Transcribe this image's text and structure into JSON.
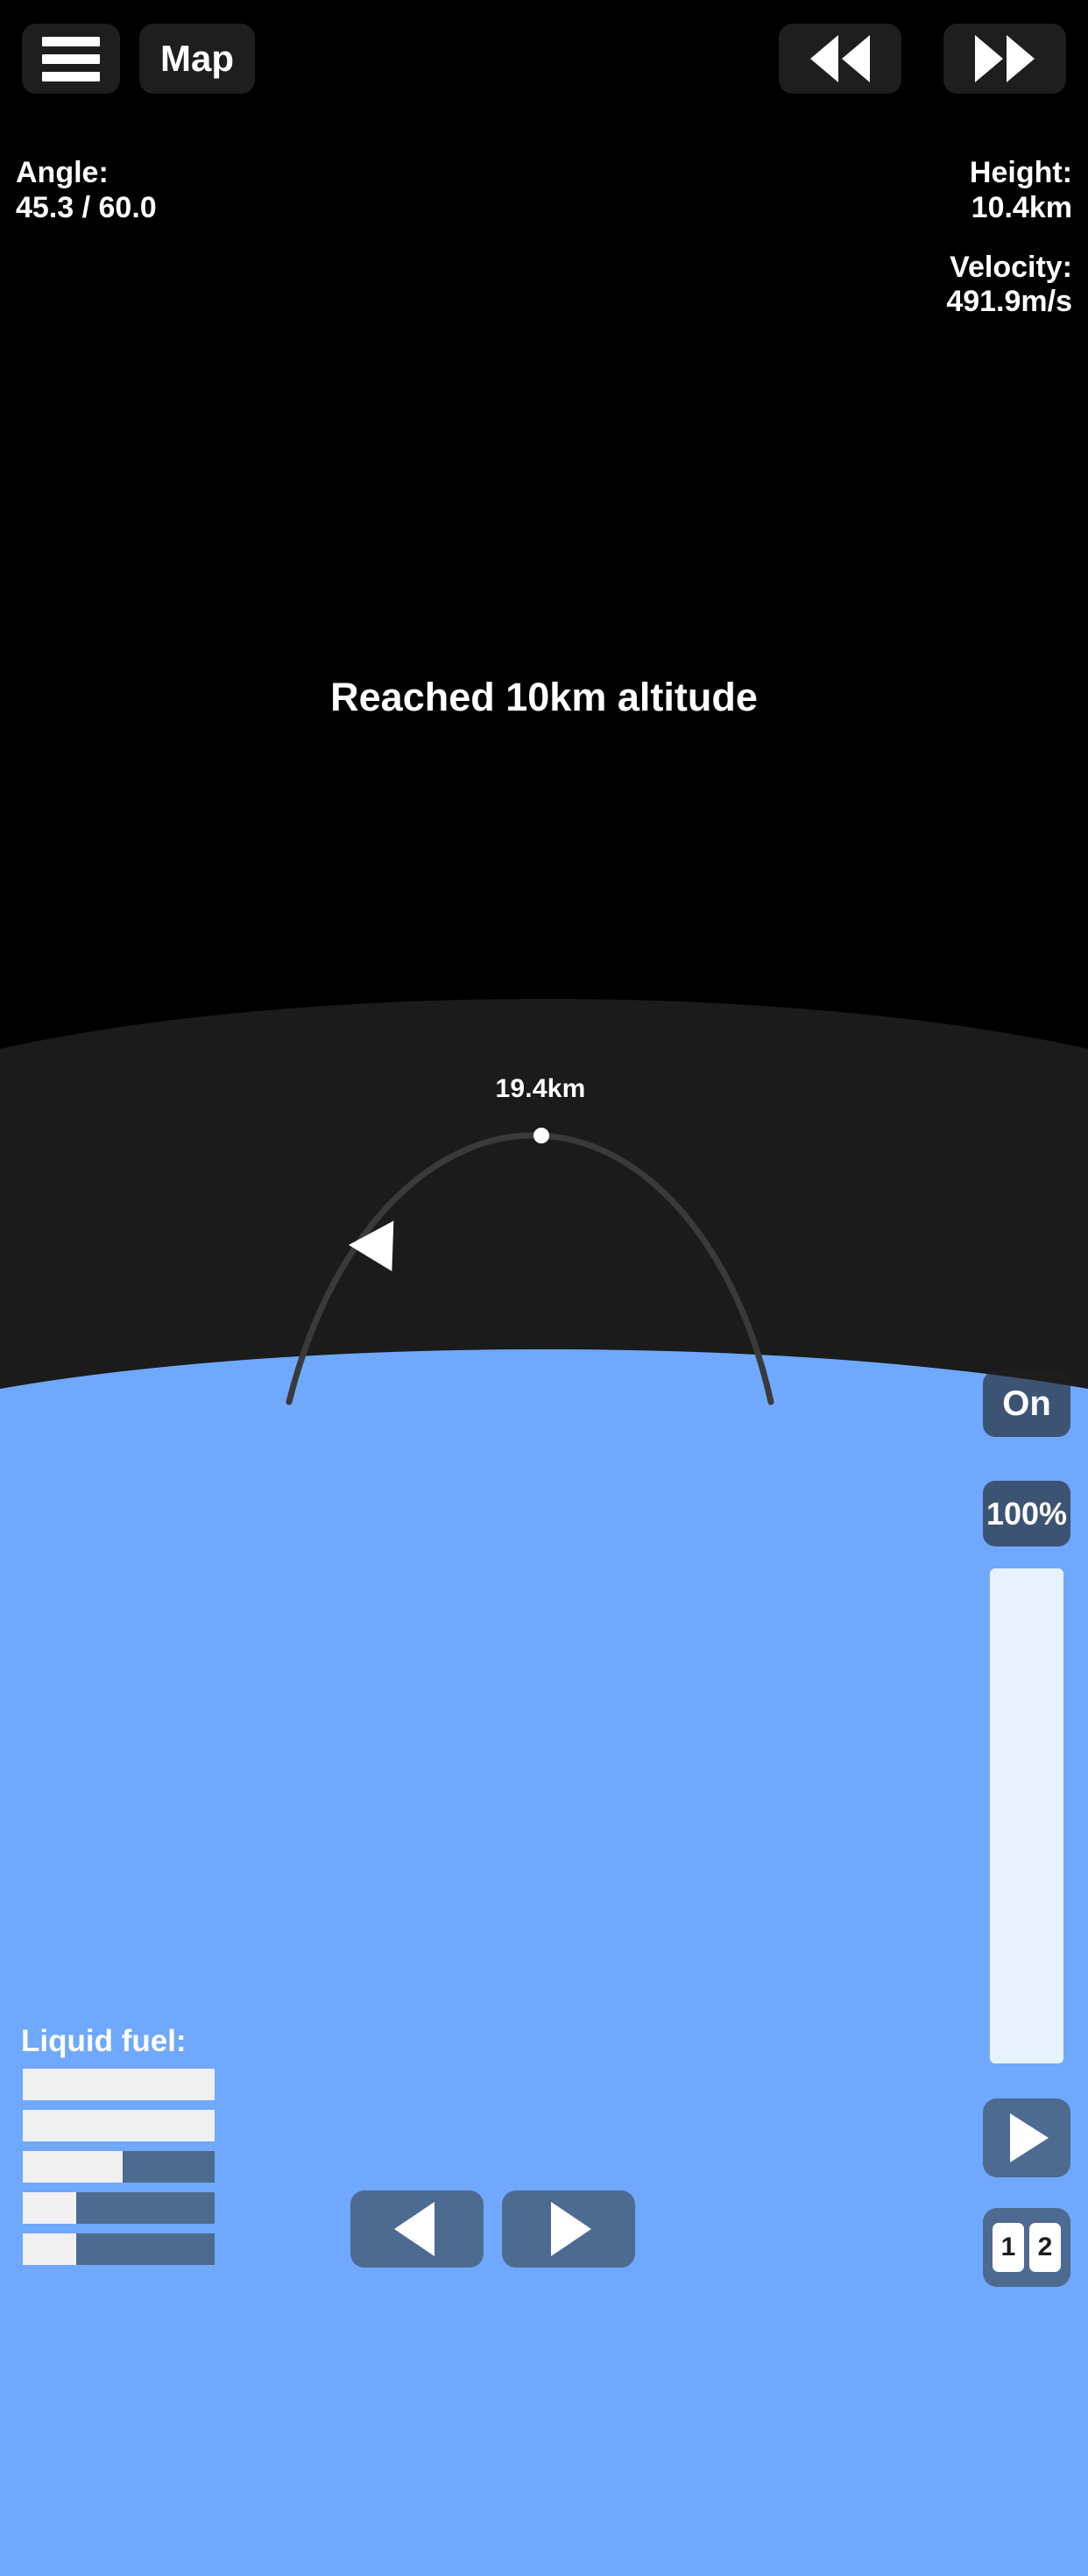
{
  "hud": {
    "menu_button": {
      "icon": "hamburger-menu-icon",
      "label": ""
    },
    "map_button": {
      "label": "Map"
    },
    "warp_down_button": {
      "icon": "rewind-icon",
      "label": ""
    },
    "warp_up_button": {
      "icon": "fast-forward-icon",
      "label": ""
    }
  },
  "telemetry": {
    "angle_label": "Angle:",
    "angle_value": "45.3 / 60.0",
    "height_label": "Height:",
    "height_value": "10.4km",
    "velocity_label": "Velocity:",
    "velocity_value": "491.9m/s"
  },
  "notification": {
    "message": "Reached 10km altitude"
  },
  "trajectory": {
    "apoapsis_label": "19.4km",
    "apoapsis_marker": "apoapsis-dot",
    "craft_marker": "rocket-arrow-icon",
    "path_color": "#3a3a3a"
  },
  "controls": {
    "engine_toggle_label": "On",
    "throttle_percent_label": "100%",
    "throttle_value": 100,
    "stage_button_icon": "play-triangle-icon",
    "stage_chips": [
      "1",
      "2"
    ],
    "rotate_left_icon": "triangle-left-icon",
    "rotate_right_icon": "triangle-right-icon"
  },
  "fuel": {
    "title": "Liquid fuel:",
    "bars": [
      100,
      100,
      52,
      28,
      28
    ]
  },
  "colors": {
    "space": "#000000",
    "atmosphere": "#1b1b1b",
    "planet": "#6fa8fc",
    "hud_button": "#1e1e1e",
    "slate_button": "#4d6a91",
    "fuel_fill": "#f0f0f0",
    "text": "#ffffff"
  }
}
